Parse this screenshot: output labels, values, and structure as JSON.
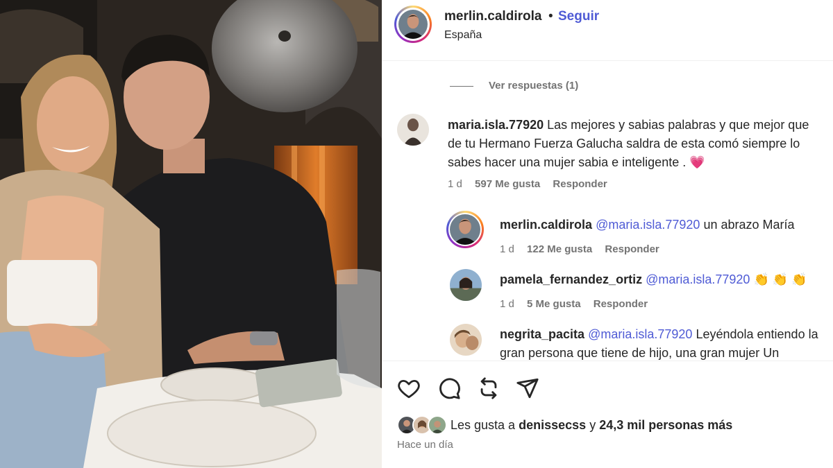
{
  "post": {
    "username": "merlin.caldirola",
    "separator": "•",
    "follow_label": "Seguir",
    "location": "España"
  },
  "view_replies": "Ver respuestas (1)",
  "comments": [
    {
      "username": "maria.isla.77920",
      "text": "Las mejores y sabias palabras y que mejor que de tu Hermano Fuerza Galucha saldra de esta comó siempre lo sabes hacer una mujer sabia e inteligente .",
      "emoji": "💗",
      "time": "1 d",
      "likes": "597 Me gusta",
      "reply_label": "Responder"
    }
  ],
  "replies": [
    {
      "username": "merlin.caldirola",
      "mention": "@maria.isla.77920",
      "text": "un abrazo María",
      "time": "1 d",
      "likes": "122 Me gusta",
      "reply_label": "Responder"
    },
    {
      "username": "pamela_fernandez_ortiz",
      "mention": "@maria.isla.77920",
      "text": "👏 👏 👏",
      "time": "1 d",
      "likes": "5 Me gusta",
      "reply_label": "Responder"
    },
    {
      "username": "negrita_pacita",
      "mention": "@maria.isla.77920",
      "text": "Leyéndola entiendo la gran persona que tiene de hijo, una gran mujer Un"
    }
  ],
  "footer": {
    "likes_prefix": "Les gusta a",
    "liker": "denissecss",
    "likes_joiner": "y",
    "likes_rest": "24,3 mil personas más",
    "time_ago": "Hace un día"
  },
  "icons": {
    "like": "heart-icon",
    "comment": "comment-icon",
    "share": "repost-icon",
    "send": "send-icon"
  },
  "colors": {
    "link": "#4f5bd5",
    "muted": "#737373",
    "text": "#262626"
  }
}
